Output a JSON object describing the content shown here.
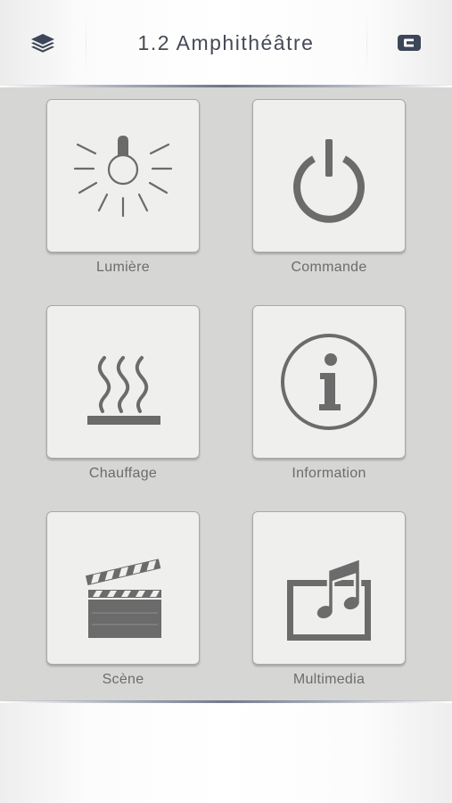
{
  "header": {
    "title": "1.2 Amphithéâtre",
    "left_icon": "layers-icon",
    "right_icon": "exit-icon"
  },
  "colors": {
    "header_text": "#454a56",
    "tile_background": "#efefed",
    "grid_background": "#d6d6d4",
    "icon_gray": "#6b6b6b",
    "label_gray": "#6c6c6c"
  },
  "tiles": [
    {
      "label": "Lumière",
      "icon": "light-bulb-icon"
    },
    {
      "label": "Commande",
      "icon": "power-icon"
    },
    {
      "label": "Chauffage",
      "icon": "heating-icon"
    },
    {
      "label": "Information",
      "icon": "info-icon"
    },
    {
      "label": "Scène",
      "icon": "clapperboard-icon"
    },
    {
      "label": "Multimedia",
      "icon": "music-note-icon"
    }
  ]
}
